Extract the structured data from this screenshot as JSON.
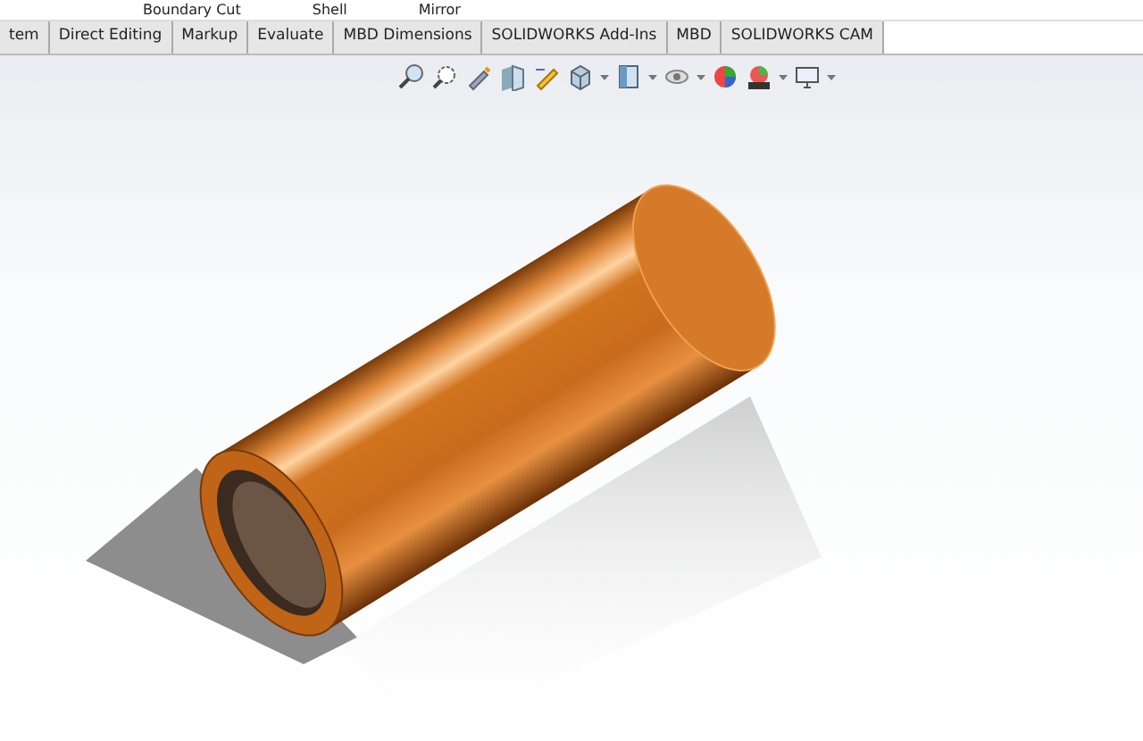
{
  "ribbon_top": {
    "items": [
      "Boundary Cut",
      "Shell",
      "Mirror"
    ]
  },
  "tabs": [
    {
      "label": "tem"
    },
    {
      "label": "Direct Editing"
    },
    {
      "label": "Markup"
    },
    {
      "label": "Evaluate"
    },
    {
      "label": "MBD Dimensions"
    },
    {
      "label": "SOLIDWORKS Add-Ins"
    },
    {
      "label": "MBD"
    },
    {
      "label": "SOLIDWORKS CAM"
    }
  ],
  "view_toolbar": {
    "tools": [
      {
        "kind": "zoom-fit"
      },
      {
        "kind": "zoom-area"
      },
      {
        "kind": "previous"
      },
      {
        "kind": "section"
      },
      {
        "kind": "dynamic"
      },
      {
        "kind": "orient"
      },
      {
        "kind": "caret"
      },
      {
        "kind": "display"
      },
      {
        "kind": "caret"
      },
      {
        "kind": "hide"
      },
      {
        "kind": "caret"
      },
      {
        "kind": "appearance"
      },
      {
        "kind": "scene"
      },
      {
        "kind": "caret"
      },
      {
        "kind": "monitor"
      },
      {
        "kind": "caret"
      }
    ]
  }
}
